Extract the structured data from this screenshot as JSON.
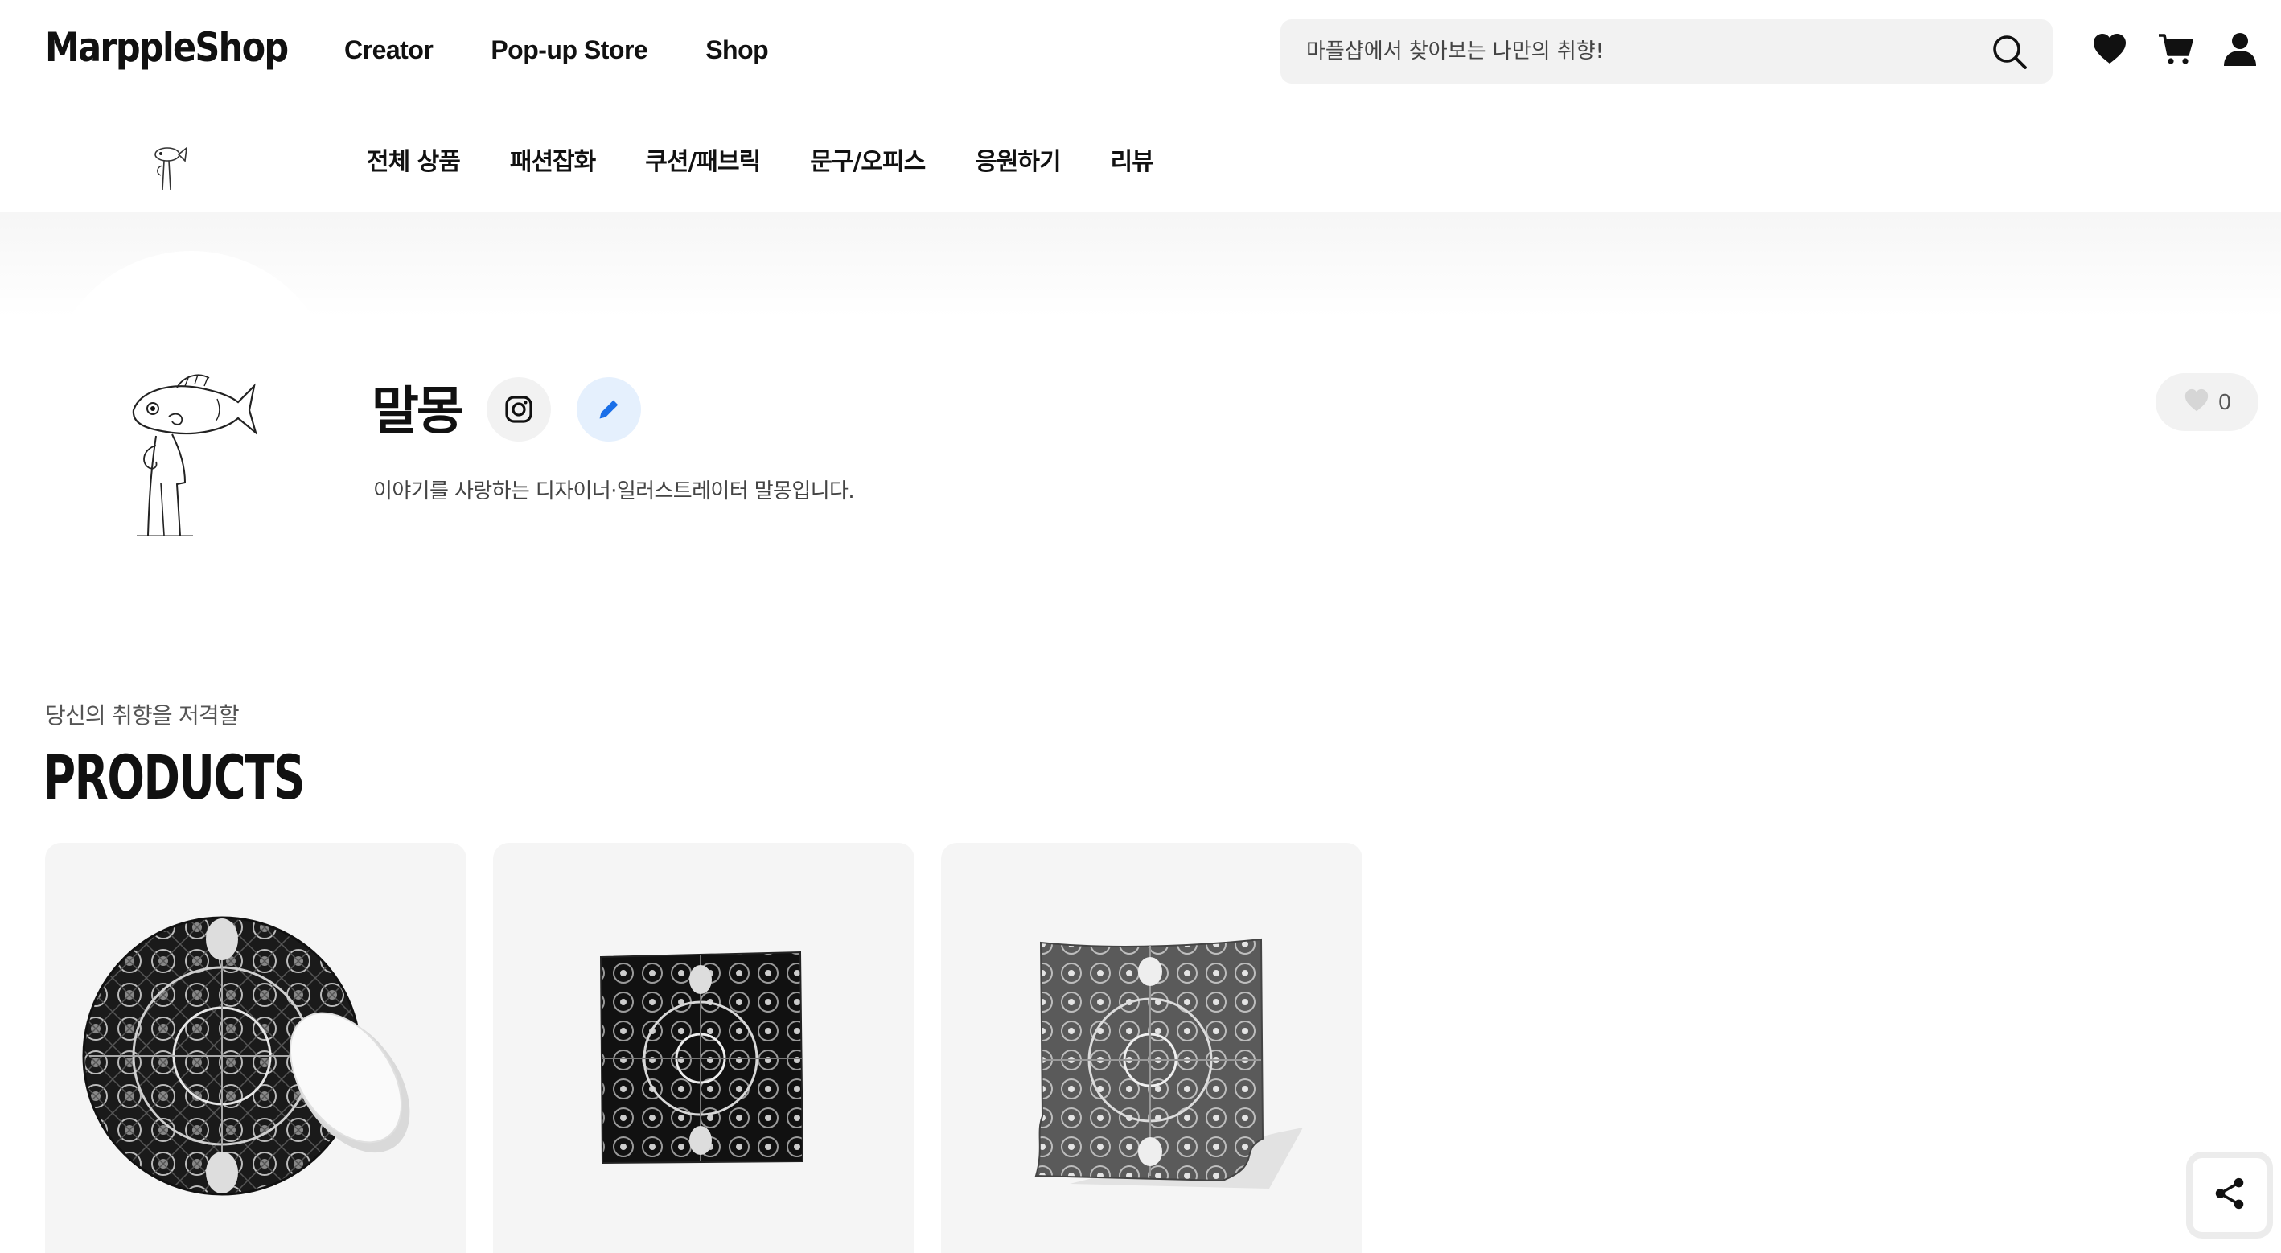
{
  "header": {
    "logo": "MarppleShop",
    "nav": [
      {
        "label": "Creator"
      },
      {
        "label": "Pop-up Store"
      },
      {
        "label": "Shop"
      }
    ],
    "search": {
      "placeholder": "마플샵에서 찾아보는 나만의 취향!"
    },
    "icons": [
      "heart-icon",
      "cart-icon",
      "user-icon",
      "search-icon"
    ]
  },
  "subnav": {
    "categories": [
      {
        "label": "전체 상품"
      },
      {
        "label": "패션잡화"
      },
      {
        "label": "쿠션/패브릭"
      },
      {
        "label": "문구/오피스"
      },
      {
        "label": "응원하기"
      },
      {
        "label": "리뷰"
      }
    ]
  },
  "profile": {
    "name": "말몽",
    "bio": "이야기를 사랑하는 디자이너·일러스트레이터 말몽입니다.",
    "like_count": "0"
  },
  "products": {
    "subtitle": "당신의 취향을 저격할",
    "title": "PRODUCTS",
    "items": [
      {
        "kind": "round-mousepad"
      },
      {
        "kind": "square-tapestry"
      },
      {
        "kind": "bandana-fabric"
      }
    ]
  },
  "colors": {
    "accent_blue": "#1a6fe8",
    "edit_bg": "#e5f0fd",
    "chip_bg": "#f2f2f2",
    "card_bg": "#f5f5f5"
  }
}
